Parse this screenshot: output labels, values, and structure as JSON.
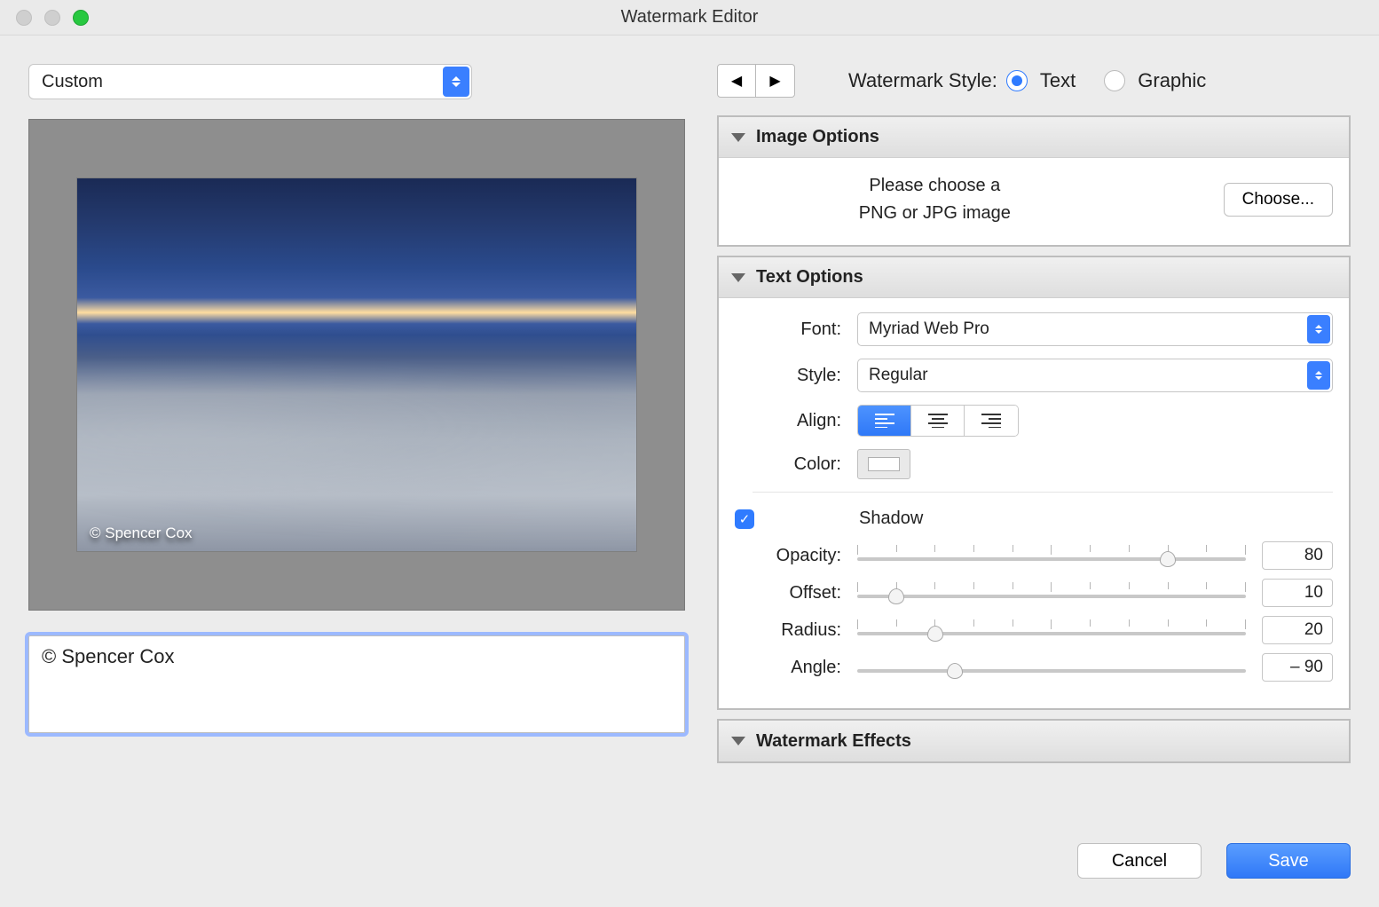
{
  "window": {
    "title": "Watermark Editor"
  },
  "preset": {
    "selected": "Custom"
  },
  "watermark_text_preview": "© Spencer Cox",
  "text_input": "© Spencer Cox",
  "style_label": "Watermark Style:",
  "style_options": {
    "text": "Text",
    "graphic": "Graphic"
  },
  "style_selected": "text",
  "panels": {
    "image_options": {
      "title": "Image Options",
      "message": "Please choose a\nPNG or JPG image",
      "choose_label": "Choose..."
    },
    "text_options": {
      "title": "Text Options",
      "font_label": "Font:",
      "font_value": "Myriad Web Pro",
      "style_label": "Style:",
      "style_value": "Regular",
      "align_label": "Align:",
      "align_value": "left",
      "color_label": "Color:",
      "color_value": "#ffffff",
      "shadow_label": "Shadow",
      "shadow_on": true,
      "opacity_label": "Opacity:",
      "opacity_value": 80,
      "offset_label": "Offset:",
      "offset_value": 10,
      "radius_label": "Radius:",
      "radius_value": 20,
      "angle_label": "Angle:",
      "angle_value": "– 90"
    },
    "watermark_effects": {
      "title": "Watermark Effects"
    }
  },
  "buttons": {
    "cancel": "Cancel",
    "save": "Save"
  }
}
